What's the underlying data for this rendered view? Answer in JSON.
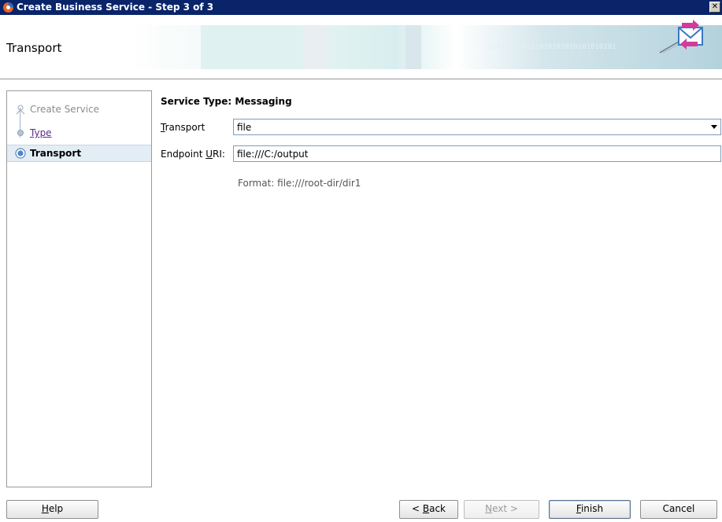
{
  "window": {
    "title": "Create Business Service - Step 3 of 3",
    "close_glyph": "✕"
  },
  "header": {
    "title": "Transport",
    "binary_text": "010101010101010101010101010101",
    "icon": "transport-mail-icon"
  },
  "nav": {
    "items": [
      {
        "label": "Create Service",
        "state": "disabled"
      },
      {
        "label": "Type",
        "state": "link"
      },
      {
        "label": "Transport",
        "state": "current"
      }
    ]
  },
  "main": {
    "section_heading": "Service Type: Messaging",
    "transport": {
      "label_mnemonic": "T",
      "label_rest": "ransport",
      "value": "file"
    },
    "endpoint": {
      "label_pre": "Endpoint ",
      "label_mnemonic": "U",
      "label_post": "RI:",
      "value": "file:///C:/output"
    },
    "format_hint": "Format:  file:///root-dir/dir1"
  },
  "buttons": {
    "help": {
      "mnemonic": "H",
      "rest": "elp"
    },
    "back": {
      "pre": "< ",
      "mnemonic": "B",
      "rest": "ack"
    },
    "next": {
      "mnemonic": "N",
      "rest": "ext >"
    },
    "finish": {
      "mnemonic": "F",
      "rest": "inish"
    },
    "cancel": "Cancel"
  },
  "colors": {
    "titlebar": "#0a246a",
    "nav_link": "#5a2c86",
    "nav_current_bg": "#e3edf5"
  }
}
